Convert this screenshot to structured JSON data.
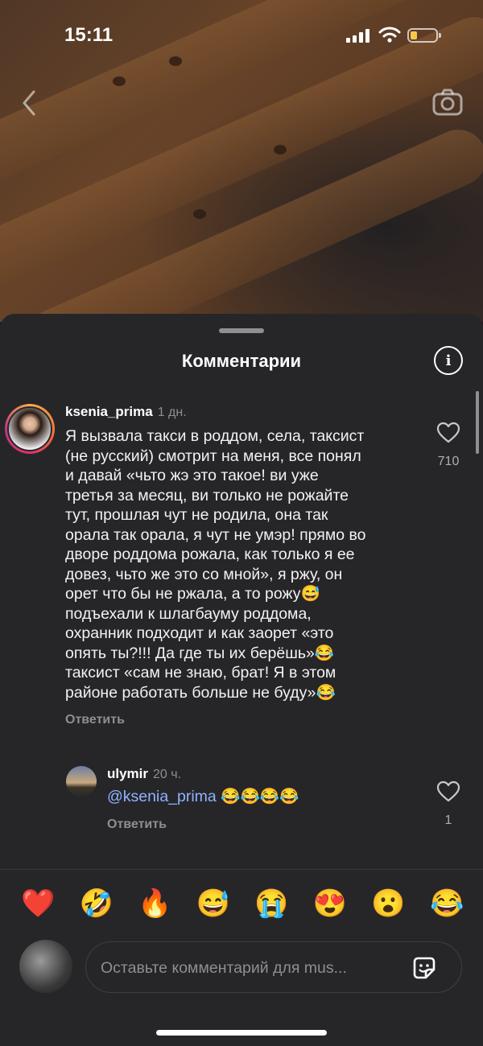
{
  "status_bar": {
    "time": "15:11"
  },
  "sheet": {
    "title": "Комментарии"
  },
  "comments": [
    {
      "username": "ksenia_prima",
      "time": "1 дн.",
      "text": "Я вызвала такси в роддом, села, таксист\n(не русский) смотрит на меня, все понял\nи давай «чьто жэ это такое! ви уже\nтретья за месяц, ви только не рожайте\nтут, прошлая чут не родила, она так\nорала так орала, я чут не умэр! прямо во\nдворе роддома рожала, как только я ее\nдовез, чьто же это со мной», я ржу, он\nорет что бы не ржала, а то рожу😅\nподъехали к шлагбауму роддома,\nохранник подходит и как заорет «это\nопять ты?!!! Да где ты их берёшь»😂\nтаксист «сам не знаю, брат! Я в этом\nрайоне работать больше не буду»😂",
      "reply_label": "Ответить",
      "likes": "710"
    },
    {
      "username": "ulymir",
      "time": "20 ч.",
      "mention": "@ksenia_prima",
      "text": " 😂😂😂😂",
      "reply_label": "Ответить",
      "likes": "1"
    }
  ],
  "emoji_bar": [
    "❤️",
    "🤣",
    "🔥",
    "😅",
    "😭",
    "😍",
    "😮",
    "😂"
  ],
  "composer": {
    "placeholder": "Оставьте комментарий для mus..."
  },
  "colors": {
    "background": "#262629",
    "mention": "#8fb3ff",
    "muted": "#8e8e93"
  }
}
